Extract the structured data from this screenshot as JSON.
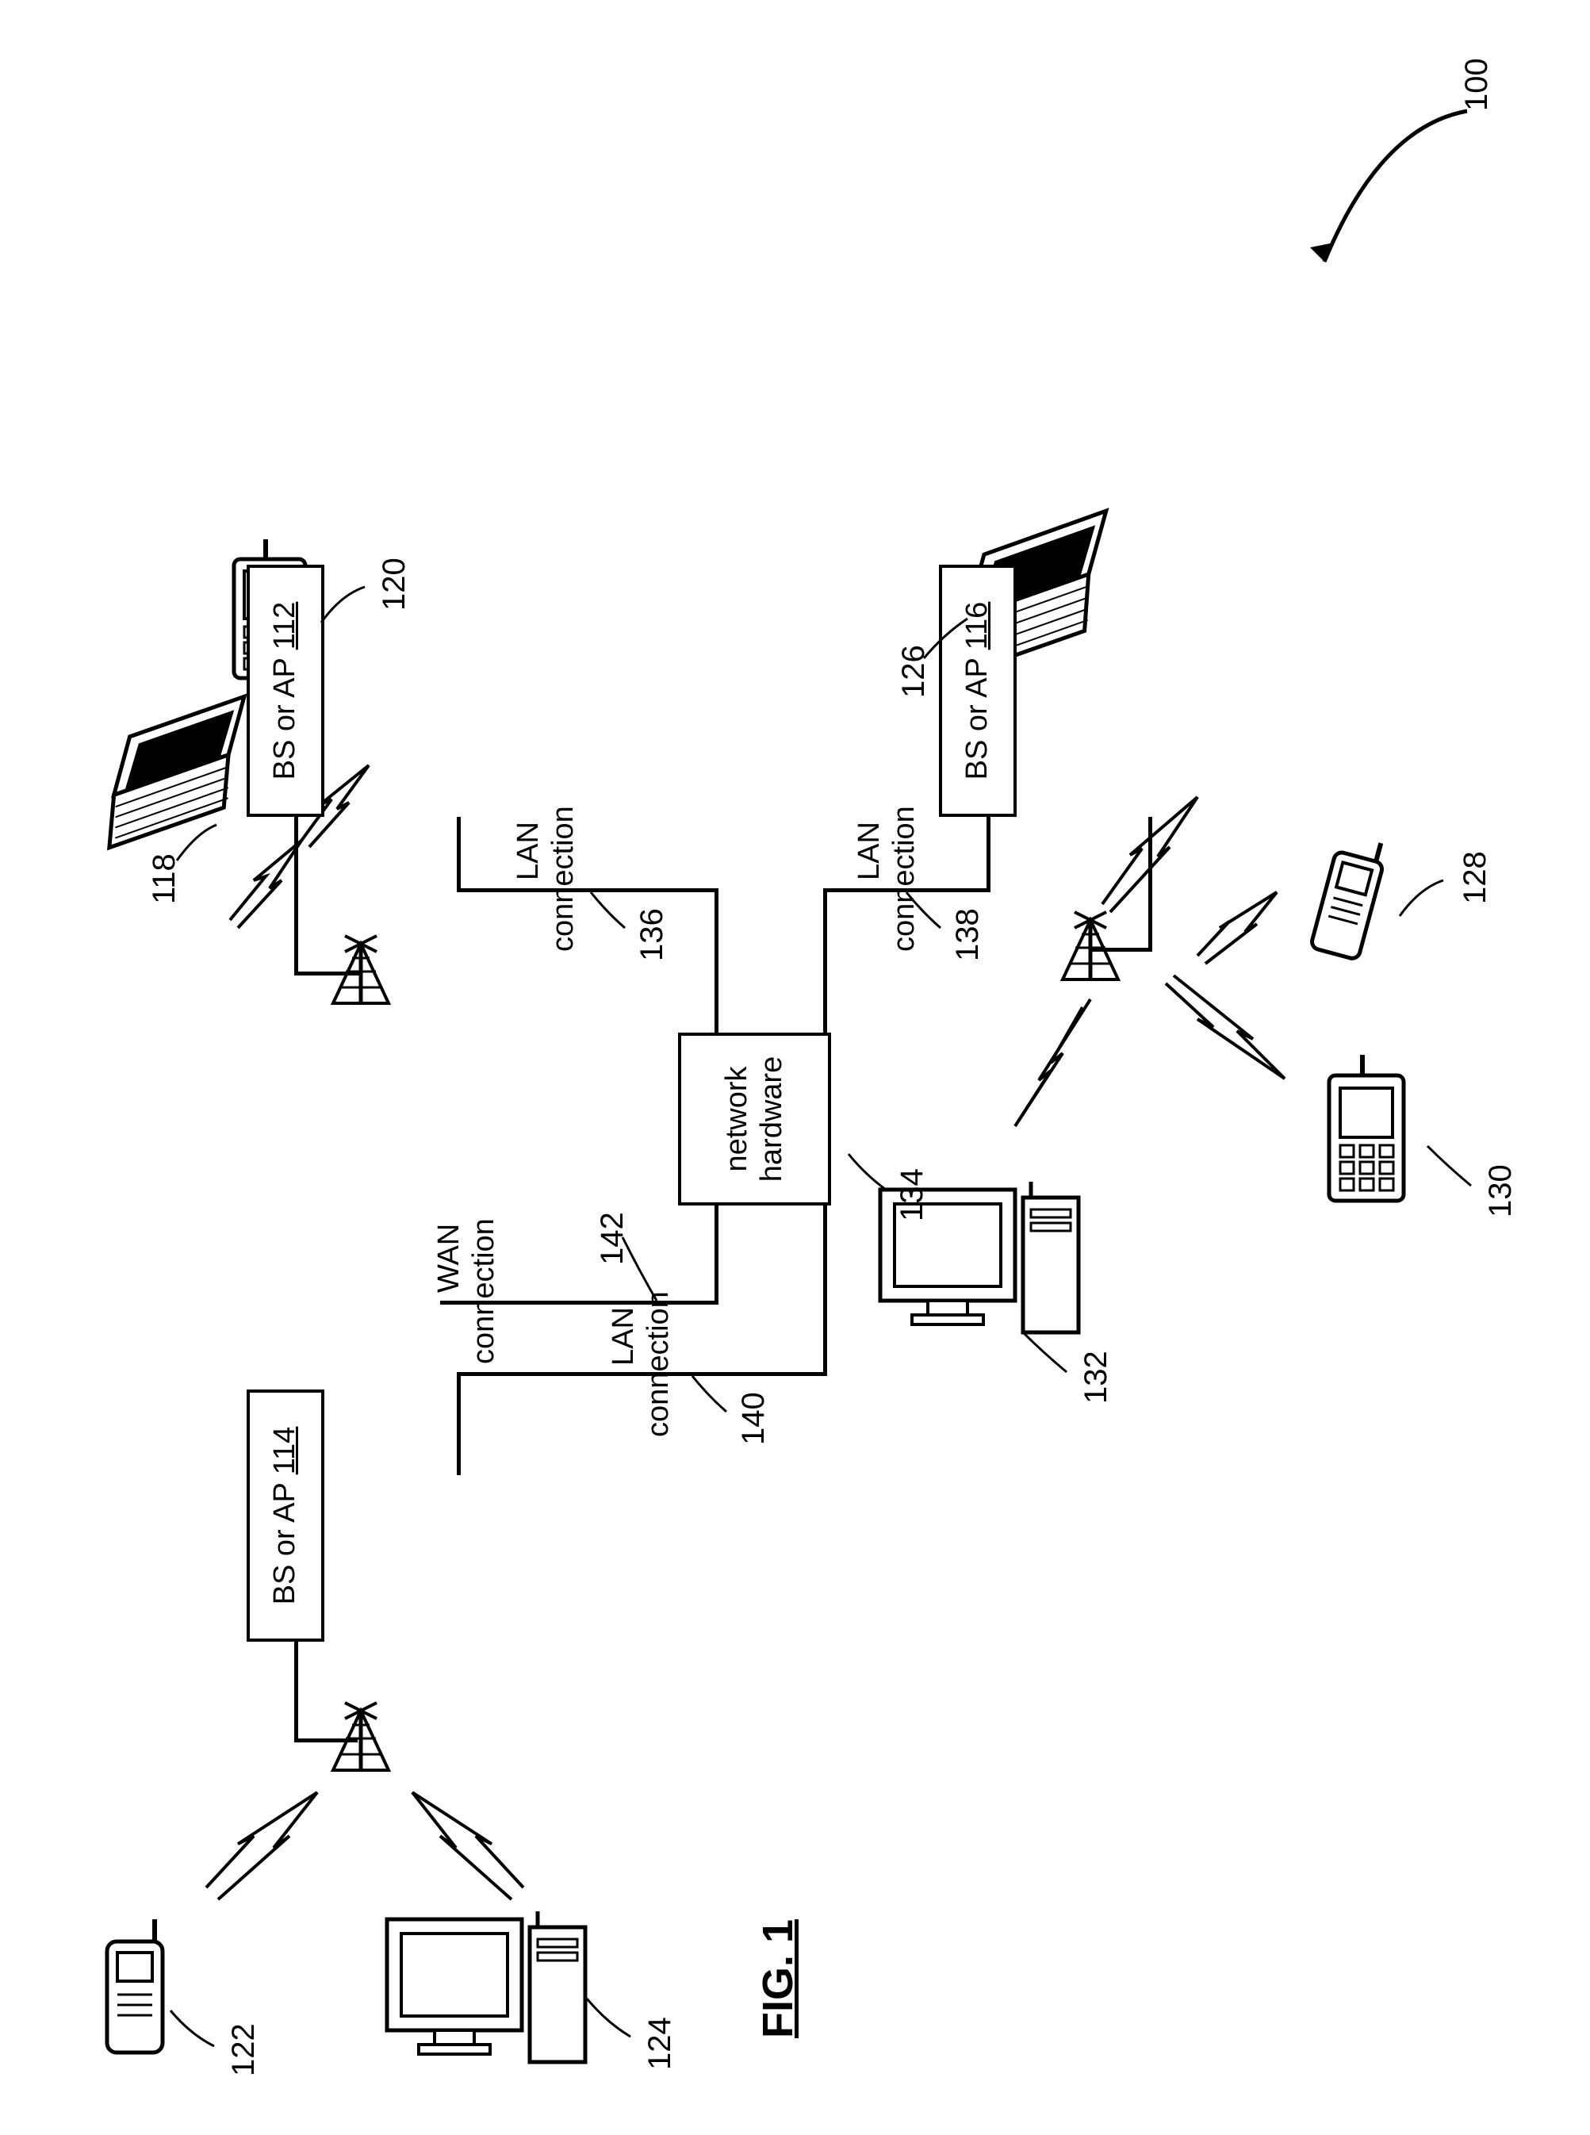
{
  "figure_label": "FIG. 1",
  "system_ref": "100",
  "boxes": {
    "ap112": {
      "text_prefix": "BS or AP ",
      "num": "112"
    },
    "ap114": {
      "text_prefix": "BS or AP ",
      "num": "114"
    },
    "ap116": {
      "text_prefix": "BS or AP ",
      "num": "116"
    },
    "nethw": {
      "line1": "network",
      "line2": "hardware"
    }
  },
  "conn_labels": {
    "lan_a": {
      "l1": "LAN",
      "l2": "connection"
    },
    "lan_b": {
      "l1": "LAN",
      "l2": "connection"
    },
    "lan_c": {
      "l1": "LAN",
      "l2": "connection"
    },
    "wan": {
      "l1": "WAN",
      "l2": "connection"
    }
  },
  "refs": {
    "r118": "118",
    "r120": "120",
    "r122": "122",
    "r124": "124",
    "r126": "126",
    "r128": "128",
    "r130": "130",
    "r132": "132",
    "r134": "134",
    "r136": "136",
    "r138": "138",
    "r140": "140",
    "r142": "142"
  }
}
